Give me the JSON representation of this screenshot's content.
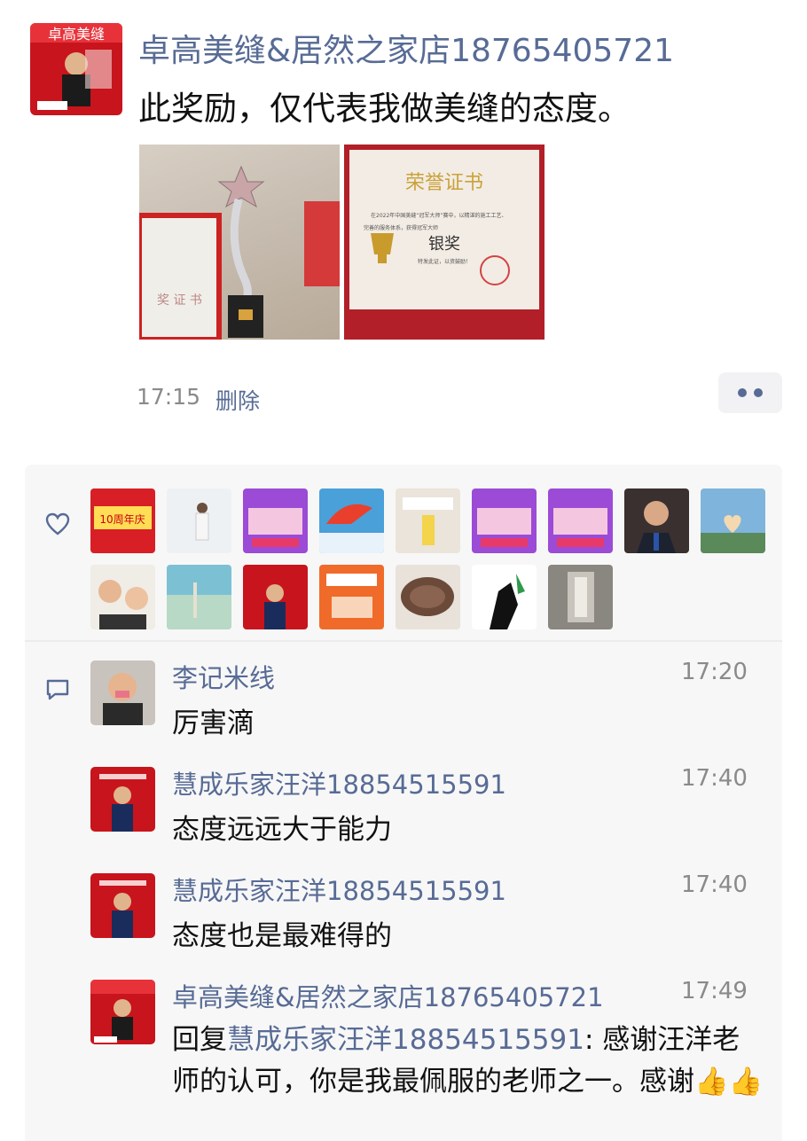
{
  "post": {
    "author": "卓高美缝&居然之家店18765405721",
    "text": "此奖励，仅代表我做美缝的态度。",
    "time": "17:15",
    "delete_label": "删除",
    "photos": [
      {
        "kind": "trophy-photo",
        "card_text": "奖 证 书"
      },
      {
        "kind": "certificate-photo",
        "title": "荣誉证书",
        "line1": "在2022年中国美缝“冠军大师”赛中，以精湛的施工工艺、",
        "line2": "完善的服务体系，获得冠军大师",
        "award": "银奖",
        "footer": "特发此证，以资鼓励！"
      }
    ]
  },
  "likes": {
    "icon": "heart-icon",
    "avatars": [
      {
        "kind": "red-ad",
        "text": "10周年庆"
      },
      {
        "kind": "person-white"
      },
      {
        "kind": "purple-ad"
      },
      {
        "kind": "paraglider"
      },
      {
        "kind": "room-interior"
      },
      {
        "kind": "purple-ad"
      },
      {
        "kind": "purple-ad"
      },
      {
        "kind": "man-suit"
      },
      {
        "kind": "heart-hand"
      },
      {
        "kind": "couple-selfie"
      },
      {
        "kind": "beach"
      },
      {
        "kind": "red-card"
      },
      {
        "kind": "orange-ad"
      },
      {
        "kind": "carved-cloud"
      },
      {
        "kind": "sketch-figure"
      },
      {
        "kind": "hallway"
      }
    ]
  },
  "comments": {
    "icon": "comment-icon",
    "items": [
      {
        "name": "李记米线",
        "time": "17:20",
        "text": "厉害滴",
        "avatar": "boy-photo"
      },
      {
        "name": "慧成乐家汪洋18854515591",
        "time": "17:40",
        "text": "态度远远大于能力",
        "avatar": "red-card"
      },
      {
        "name": "慧成乐家汪洋18854515591",
        "time": "17:40",
        "text": "态度也是最难得的",
        "avatar": "red-card"
      },
      {
        "name": "卓高美缝&居然之家店18765405721",
        "time": "17:49",
        "reply_prefix": "回复",
        "reply_to": "慧成乐家汪洋18854515591",
        "reply_colon": ": ",
        "text": "感谢汪洋老师的认可，你是我最佩服的老师之一。感谢",
        "emoji": "👍👍",
        "avatar": "shop-logo"
      }
    ]
  },
  "colors": {
    "link": "#576b95",
    "panel": "#f7f7f7",
    "time": "#8a8a8a"
  }
}
